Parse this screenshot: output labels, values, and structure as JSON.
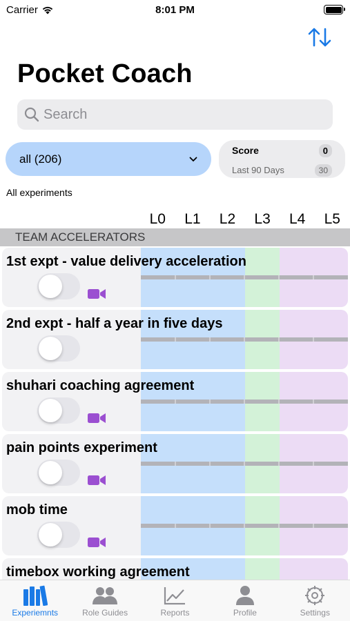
{
  "status_bar": {
    "carrier": "Carrier",
    "time": "8:01 PM"
  },
  "header": {
    "title": "Pocket Coach",
    "sort_icon": "sort-arrows-icon"
  },
  "search": {
    "placeholder": "Search"
  },
  "filter": {
    "selected": "all (206)"
  },
  "score": {
    "label": "Score",
    "value": "0",
    "period": "Last 90 Days",
    "period_days": "30"
  },
  "list_caption": "All experiments",
  "levels": [
    "L0",
    "L1",
    "L2",
    "L3",
    "L4",
    "L5"
  ],
  "section": {
    "title": "TEAM ACCELERATORS"
  },
  "experiments": [
    {
      "name": "1st expt - value delivery acceleration",
      "enabled": false,
      "has_video": true
    },
    {
      "name": "2nd expt - half a year in five days",
      "enabled": false,
      "has_video": false
    },
    {
      "name": "shuhari coaching agreement",
      "enabled": false,
      "has_video": true
    },
    {
      "name": "pain points experiment",
      "enabled": false,
      "has_video": true
    },
    {
      "name": "mob time",
      "enabled": false,
      "has_video": true
    },
    {
      "name": "timebox working agreement",
      "enabled": false,
      "has_video": false
    }
  ],
  "tabs": [
    {
      "label": "Experiemnts",
      "icon": "books-icon",
      "active": true
    },
    {
      "label": "Role Guides",
      "icon": "people-icon",
      "active": false
    },
    {
      "label": "Reports",
      "icon": "chart-icon",
      "active": false
    },
    {
      "label": "Profile",
      "icon": "person-icon",
      "active": false
    },
    {
      "label": "Settings",
      "icon": "gear-icon",
      "active": false
    }
  ],
  "colors": {
    "accent": "#1a7ae6",
    "level_blue": "#c5dffb",
    "level_green": "#d3f2d8",
    "level_purple": "#ecdcf5",
    "video": "#9b4fd1"
  }
}
